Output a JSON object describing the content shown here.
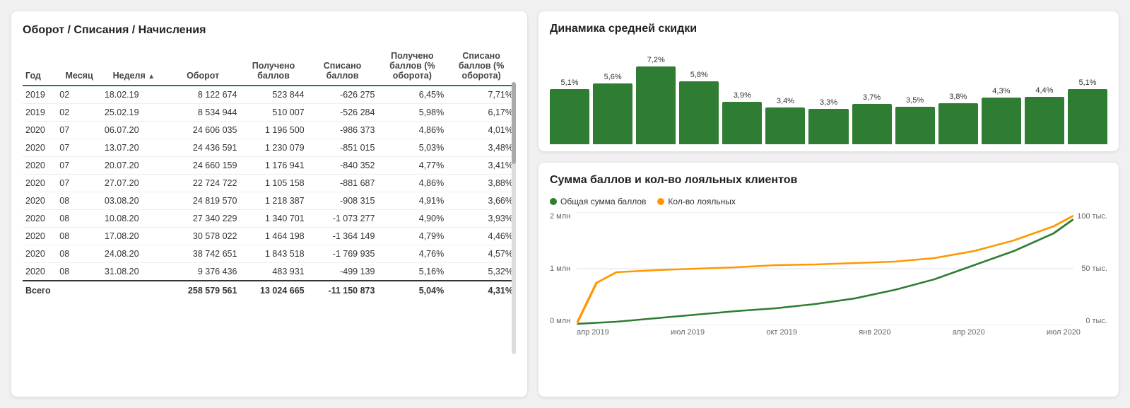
{
  "left_panel": {
    "title": "Оборот / Списания / Начисления",
    "table": {
      "headers": [
        "Год",
        "Месяц",
        "Неделя",
        "Оборот",
        "Получено баллов",
        "Списано баллов",
        "Получено баллов (% оборота)",
        "Списано баллов (% оборота)"
      ],
      "rows": [
        [
          "2019",
          "02",
          "18.02.19",
          "8 122 674",
          "523 844",
          "-626 275",
          "6,45%",
          "7,71%"
        ],
        [
          "2019",
          "02",
          "25.02.19",
          "8 534 944",
          "510 007",
          "-526 284",
          "5,98%",
          "6,17%"
        ],
        [
          "2020",
          "07",
          "06.07.20",
          "24 606 035",
          "1 196 500",
          "-986 373",
          "4,86%",
          "4,01%"
        ],
        [
          "2020",
          "07",
          "13.07.20",
          "24 436 591",
          "1 230 079",
          "-851 015",
          "5,03%",
          "3,48%"
        ],
        [
          "2020",
          "07",
          "20.07.20",
          "24 660 159",
          "1 176 941",
          "-840 352",
          "4,77%",
          "3,41%"
        ],
        [
          "2020",
          "07",
          "27.07.20",
          "22 724 722",
          "1 105 158",
          "-881 687",
          "4,86%",
          "3,88%"
        ],
        [
          "2020",
          "08",
          "03.08.20",
          "24 819 570",
          "1 218 387",
          "-908 315",
          "4,91%",
          "3,66%"
        ],
        [
          "2020",
          "08",
          "10.08.20",
          "27 340 229",
          "1 340 701",
          "-1 073 277",
          "4,90%",
          "3,93%"
        ],
        [
          "2020",
          "08",
          "17.08.20",
          "30 578 022",
          "1 464 198",
          "-1 364 149",
          "4,79%",
          "4,46%"
        ],
        [
          "2020",
          "08",
          "24.08.20",
          "38 742 651",
          "1 843 518",
          "-1 769 935",
          "4,76%",
          "4,57%"
        ],
        [
          "2020",
          "08",
          "31.08.20",
          "9 376 436",
          "483 931",
          "-499 139",
          "5,16%",
          "5,32%"
        ]
      ],
      "footer": [
        "Всего",
        "",
        "",
        "258 579 561",
        "13 024 665",
        "-11 150 873",
        "5,04%",
        "4,31%"
      ]
    }
  },
  "right_top": {
    "title": "Динамика средней скидки",
    "bars": [
      {
        "label": "5,1%",
        "value": 5.1
      },
      {
        "label": "5,6%",
        "value": 5.6
      },
      {
        "label": "7,2%",
        "value": 7.2
      },
      {
        "label": "5,8%",
        "value": 5.8
      },
      {
        "label": "3,9%",
        "value": 3.9
      },
      {
        "label": "3,4%",
        "value": 3.4
      },
      {
        "label": "3,3%",
        "value": 3.3
      },
      {
        "label": "3,7%",
        "value": 3.7
      },
      {
        "label": "3,5%",
        "value": 3.5
      },
      {
        "label": "3,8%",
        "value": 3.8
      },
      {
        "label": "4,3%",
        "value": 4.3
      },
      {
        "label": "4,4%",
        "value": 4.4
      },
      {
        "label": "5,1%",
        "value": 5.1
      }
    ]
  },
  "right_bottom": {
    "title": "Сумма баллов и кол-во лояльных клиентов",
    "legend": [
      {
        "label": "Общая сумма баллов",
        "color": "#2e7d32"
      },
      {
        "label": "Кол-во лояльных",
        "color": "#ff9800"
      }
    ],
    "y_left": [
      "2 млн",
      "1 млн",
      "0 млн"
    ],
    "y_right": [
      "100 тыс.",
      "50 тыс.",
      "0 тыс."
    ],
    "x_labels": [
      "апр 2019",
      "июл 2019",
      "окт 2019",
      "янв 2020",
      "апр 2020",
      "июл 2020"
    ]
  }
}
